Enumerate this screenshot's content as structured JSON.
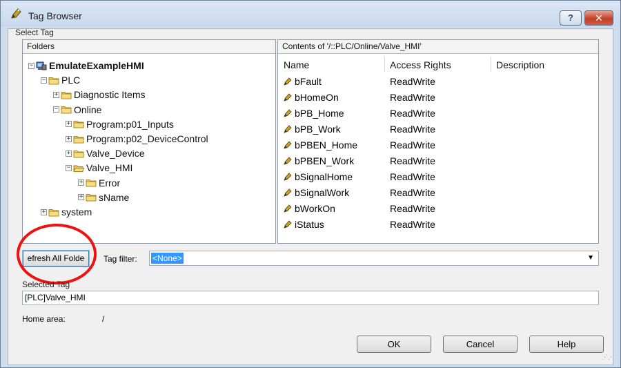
{
  "window": {
    "title": "Tag Browser",
    "help_glyph": "?",
    "close_glyph": "✕"
  },
  "select_tag_label": "Select Tag",
  "folders": {
    "header": "Folders",
    "tree": [
      {
        "label": "EmulateExampleHMI",
        "depth": 0,
        "expander": "−",
        "icon": "computer-icon",
        "bold": true
      },
      {
        "label": "PLC",
        "depth": 1,
        "expander": "−",
        "icon": "folder-icon"
      },
      {
        "label": "Diagnostic Items",
        "depth": 2,
        "expander": "+",
        "icon": "folder-icon"
      },
      {
        "label": "Online",
        "depth": 2,
        "expander": "−",
        "icon": "folder-icon"
      },
      {
        "label": "Program:p01_Inputs",
        "depth": 3,
        "expander": "+",
        "icon": "folder-icon"
      },
      {
        "label": "Program:p02_DeviceControl",
        "depth": 3,
        "expander": "+",
        "icon": "folder-icon"
      },
      {
        "label": "Valve_Device",
        "depth": 3,
        "expander": "+",
        "icon": "folder-icon"
      },
      {
        "label": "Valve_HMI",
        "depth": 3,
        "expander": "−",
        "icon": "open-folder-icon"
      },
      {
        "label": "Error",
        "depth": 4,
        "expander": "+",
        "icon": "folder-icon"
      },
      {
        "label": "sName",
        "depth": 4,
        "expander": "+",
        "icon": "folder-icon"
      },
      {
        "label": "system",
        "depth": 1,
        "expander": "+",
        "icon": "folder-icon"
      }
    ]
  },
  "contents": {
    "header": "Contents of '/::PLC/Online/Valve_HMI'",
    "columns": [
      "Name",
      "Access Rights",
      "Description"
    ],
    "rows": [
      {
        "name": "bFault",
        "access": "ReadWrite"
      },
      {
        "name": "bHomeOn",
        "access": "ReadWrite"
      },
      {
        "name": "bPB_Home",
        "access": "ReadWrite"
      },
      {
        "name": "bPB_Work",
        "access": "ReadWrite"
      },
      {
        "name": "bPBEN_Home",
        "access": "ReadWrite"
      },
      {
        "name": "bPBEN_Work",
        "access": "ReadWrite"
      },
      {
        "name": "bSignalHome",
        "access": "ReadWrite"
      },
      {
        "name": "bSignalWork",
        "access": "ReadWrite"
      },
      {
        "name": "bWorkOn",
        "access": "ReadWrite"
      },
      {
        "name": "iStatus",
        "access": "ReadWrite"
      }
    ]
  },
  "refresh_button": "efresh All Folde",
  "tag_filter": {
    "label": "Tag filter:",
    "value": "<None>"
  },
  "selected_tag": {
    "label": "Selected Tag",
    "value": "[PLC]Valve_HMI"
  },
  "home_area": {
    "label": "Home area:",
    "value": "/"
  },
  "buttons": {
    "ok": "OK",
    "cancel": "Cancel",
    "help": "Help"
  },
  "colors": {
    "annotation_circle": "#ee1111",
    "selection": "#3399ff"
  }
}
